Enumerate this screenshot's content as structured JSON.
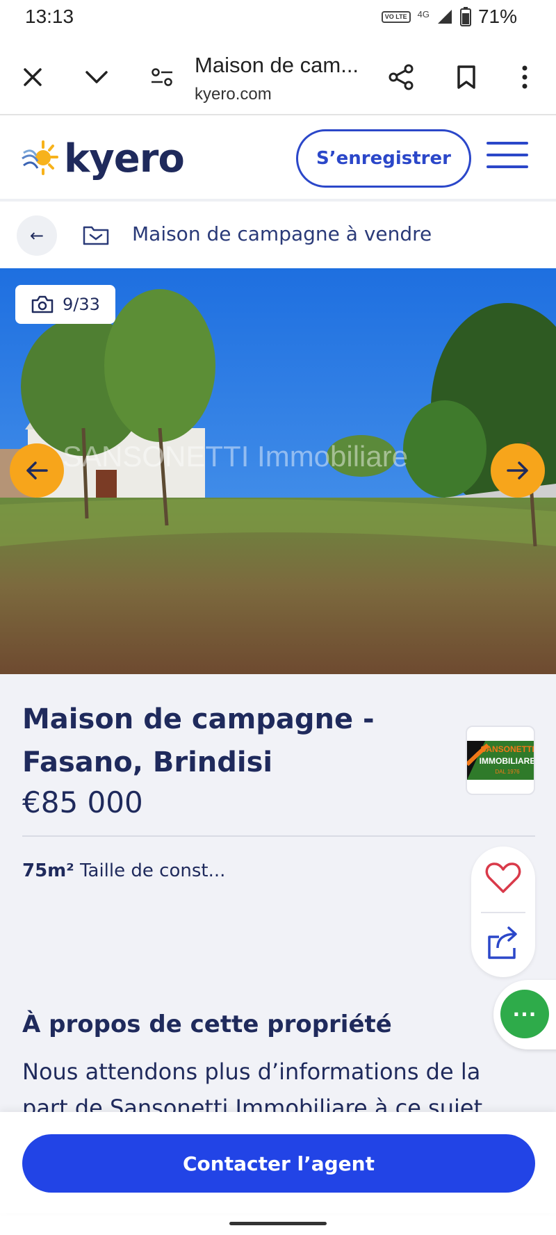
{
  "status_bar": {
    "time": "13:13",
    "volte": "VO LTE",
    "network": "4G",
    "battery": "71%"
  },
  "browser": {
    "title": "Maison de cam...",
    "url": "kyero.com"
  },
  "header": {
    "logo_text": "kyero",
    "register_label": "S’enregistrer"
  },
  "breadcrumb": {
    "back_symbol": "←",
    "label": "Maison de campagne à vendre"
  },
  "gallery": {
    "counter": "9/33",
    "watermark": "SANSONETTI Immobiliare"
  },
  "listing": {
    "title": "Maison de campagne - Fasano, Brindisi",
    "price": "€85 000",
    "size_value": "75m²",
    "size_label": "Taille de const...",
    "agent_logo_line1": "SANSONETTI",
    "agent_logo_line2": "IMMOBILIARE",
    "agent_logo_line3": "DAL 1976",
    "chat_symbol": "···"
  },
  "about": {
    "title": "À propos de cette propriété",
    "text": "Nous attendons plus d’informations de la part de Sansonetti Immobiliare à ce sujet"
  },
  "cta": {
    "contact_label": "Contacter l’agent"
  },
  "colors": {
    "brand_navy": "#1f2a5c",
    "brand_blue": "#2b47c9",
    "cta_blue": "#2244e6",
    "arrow_orange": "#f7a51b",
    "chat_green": "#2eab4a",
    "heart_red": "#d93a4a"
  }
}
